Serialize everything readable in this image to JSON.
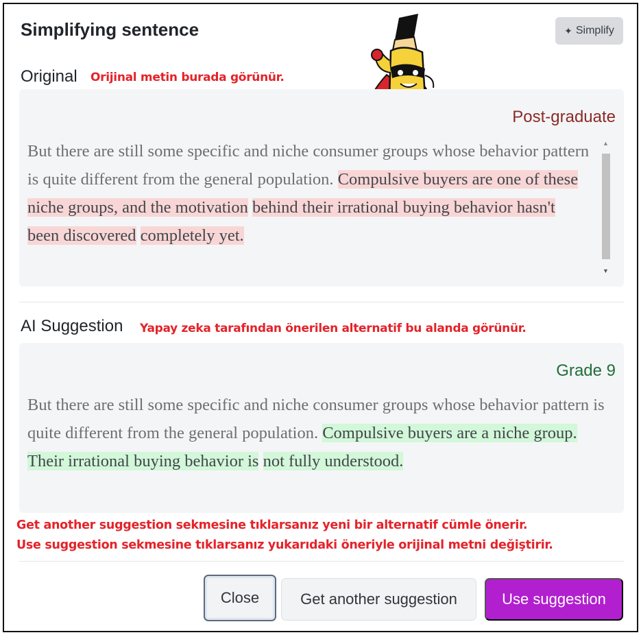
{
  "dialog": {
    "title": "Simplifying sentence",
    "simplify_button": "Simplify"
  },
  "original": {
    "label": "Original",
    "note": "Orijinal metin burada görünür.",
    "level": "Post-graduate",
    "text_plain": "But there are still some specific and niche consumer groups whose behavior pattern is quite different from the general population.",
    "text_lines_highlight": [
      "Compulsive buyers are one of these niche groups, and the motivation",
      "behind their irrational buying behavior hasn't been discovered",
      "completely yet."
    ]
  },
  "ai_suggestion": {
    "label": "AI Suggestion",
    "note": "Yapay zeka tarafından önerilen alternatif bu alanda görünür.",
    "level": "Grade 9",
    "text_plain": "But there are still some specific and niche consumer groups whose behavior pattern is quite different from the general population.",
    "text_lines_highlight": [
      "Compulsive buyers are a niche group. Their irrational buying behavior is",
      "not fully understood."
    ]
  },
  "footer_notes": [
    "Get another suggestion sekmesine tıklarsanız yeni bir alternatif cümle önerir.",
    "Use suggestion sekmesine tıklarsanız yukarıdaki öneriyle orijinal metni değiştirir."
  ],
  "buttons": {
    "close": "Close",
    "another": "Get another suggestion",
    "use": "Use suggestion"
  },
  "colors": {
    "accent_button": "#b21fcf",
    "highlight_original": "#f9d6d6",
    "highlight_ai": "#d2f7d9",
    "annotation": "#e4232a",
    "level_original": "#8a2b27",
    "level_ai": "#1f6f3a"
  },
  "icons": {
    "simplify": "magic-wand-icon",
    "mascot": "pencil-superhero-mascot"
  }
}
